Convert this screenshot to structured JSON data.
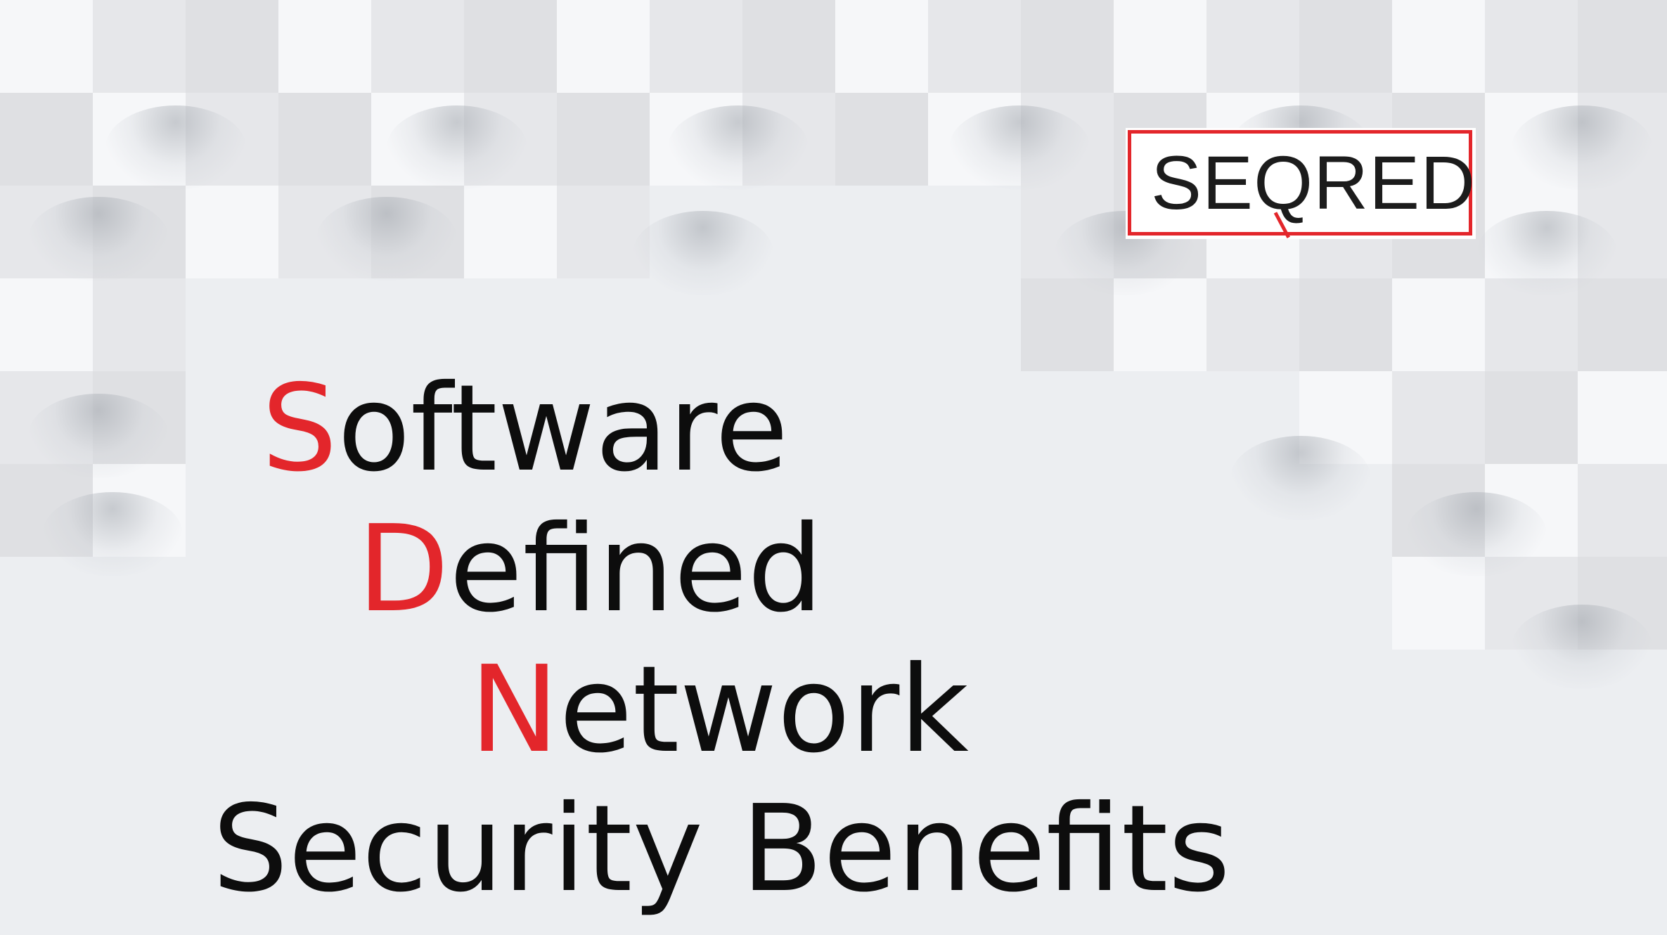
{
  "logo": {
    "text_before": "SE",
    "text_q": "Q",
    "text_after": "RED",
    "frame_color": "#e3262b"
  },
  "title": {
    "line1": {
      "initial": "S",
      "rest": "oftware"
    },
    "line2": {
      "initial": "D",
      "rest": "efined"
    },
    "line3": {
      "initial": "N",
      "rest": "etwork"
    },
    "line4": "Security Benefits"
  },
  "colors": {
    "accent": "#e3262b",
    "text": "#0d0d0d",
    "background": "#eceef1"
  }
}
